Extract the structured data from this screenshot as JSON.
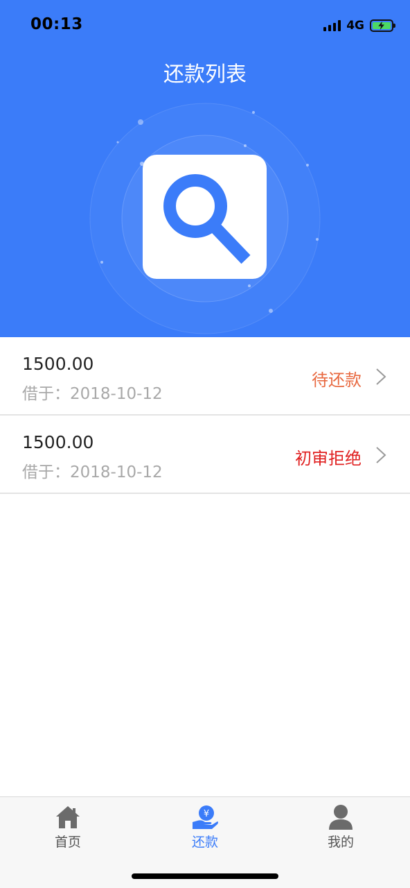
{
  "status_bar": {
    "time": "00:13",
    "network": "4G"
  },
  "header": {
    "title": "还款列表"
  },
  "colors": {
    "primary": "#3b7cf9",
    "pending": "#e8683f",
    "rejected": "#e02020"
  },
  "loans": [
    {
      "amount": "1500.00",
      "date_label": "借于：",
      "date": "2018-10-12",
      "status": "待还款"
    },
    {
      "amount": "1500.00",
      "date_label": "借于：",
      "date": "2018-10-12",
      "status": "初审拒绝"
    }
  ],
  "tabbar": {
    "items": [
      {
        "label": "首页",
        "icon": "home-icon",
        "active": false
      },
      {
        "label": "还款",
        "icon": "repay-hand-yen-icon",
        "active": true
      },
      {
        "label": "我的",
        "icon": "user-icon",
        "active": false
      }
    ]
  }
}
